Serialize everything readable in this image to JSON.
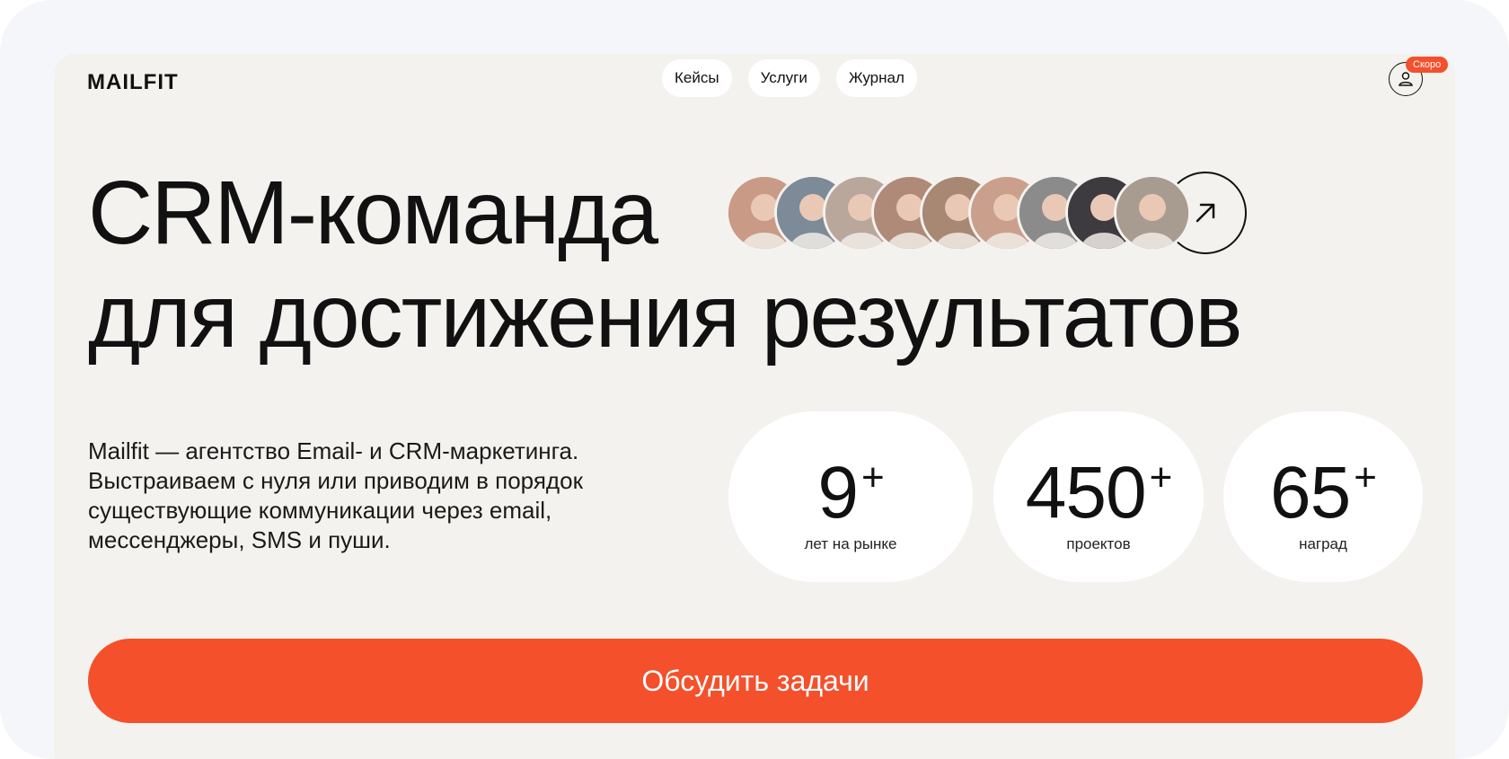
{
  "header": {
    "logo": "MAILFIT",
    "nav": [
      "Кейсы",
      "Услуги",
      "Журнал"
    ],
    "badge": "Скоро"
  },
  "hero": {
    "title_line1": "CRM-команда",
    "title_line2": "для достижения результатов",
    "avatars": [
      {
        "name": "team-member-1",
        "color": "#c99a85"
      },
      {
        "name": "team-member-2",
        "color": "#7d8a98"
      },
      {
        "name": "team-member-3",
        "color": "#b9a79c"
      },
      {
        "name": "team-member-4",
        "color": "#b08a78"
      },
      {
        "name": "team-member-5",
        "color": "#a88773"
      },
      {
        "name": "team-member-6",
        "color": "#caa08c"
      },
      {
        "name": "team-member-7",
        "color": "#8b8b8b"
      },
      {
        "name": "team-member-8",
        "color": "#3d3a40"
      },
      {
        "name": "team-member-9",
        "color": "#a89b90"
      }
    ]
  },
  "description": "Mailfit — агентство Email- и CRM-маркетинга. Выстраиваем с нуля или приводим в порядок существующие коммуникации через email, мессенджеры, SMS и пуши.",
  "stats": [
    {
      "value": "9",
      "suffix": "+",
      "label": "лет на рынке"
    },
    {
      "value": "450",
      "suffix": "+",
      "label": "проектов"
    },
    {
      "value": "65",
      "suffix": "+",
      "label": "наград"
    }
  ],
  "cta": {
    "label": "Обсудить задачи"
  },
  "colors": {
    "accent": "#f4502c",
    "panel": "#f4f2ee",
    "text": "#111111"
  }
}
